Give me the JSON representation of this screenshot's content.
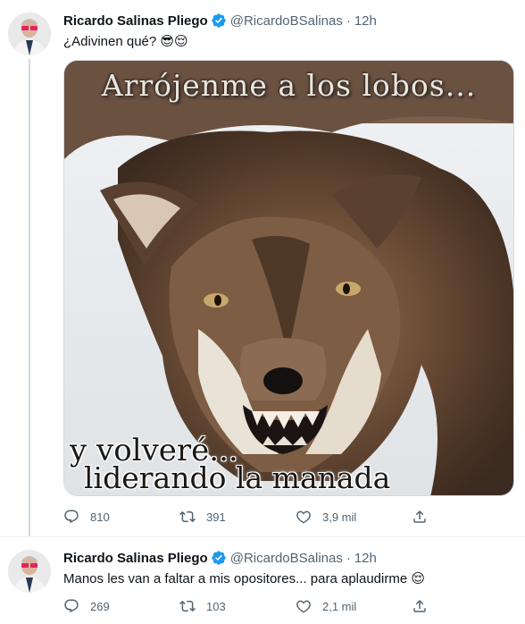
{
  "tweets": [
    {
      "author_name": "Ricardo Salinas Pliego",
      "handle": "@RicardoBSalinas",
      "separator": "·",
      "time": "12h",
      "text": "¿Adivinen qué? 😎😌",
      "image": {
        "caption_top": "Arrójenme a los lobos...",
        "caption_bottom_1": "y volveré...",
        "caption_bottom_2": "liderando la manada",
        "icon": "wolf-photo"
      },
      "replies": "810",
      "retweets": "391",
      "likes": "3,9 mil"
    },
    {
      "author_name": "Ricardo Salinas Pliego",
      "handle": "@RicardoBSalinas",
      "separator": "·",
      "time": "12h",
      "text": "Manos les van a faltar a mis opositores... para aplaudirme 😌",
      "replies": "269",
      "retweets": "103",
      "likes": "2,1 mil"
    }
  ],
  "colors": {
    "verified": "#1d9bf0",
    "muted": "#536471",
    "thread_line": "#cfd9de"
  }
}
